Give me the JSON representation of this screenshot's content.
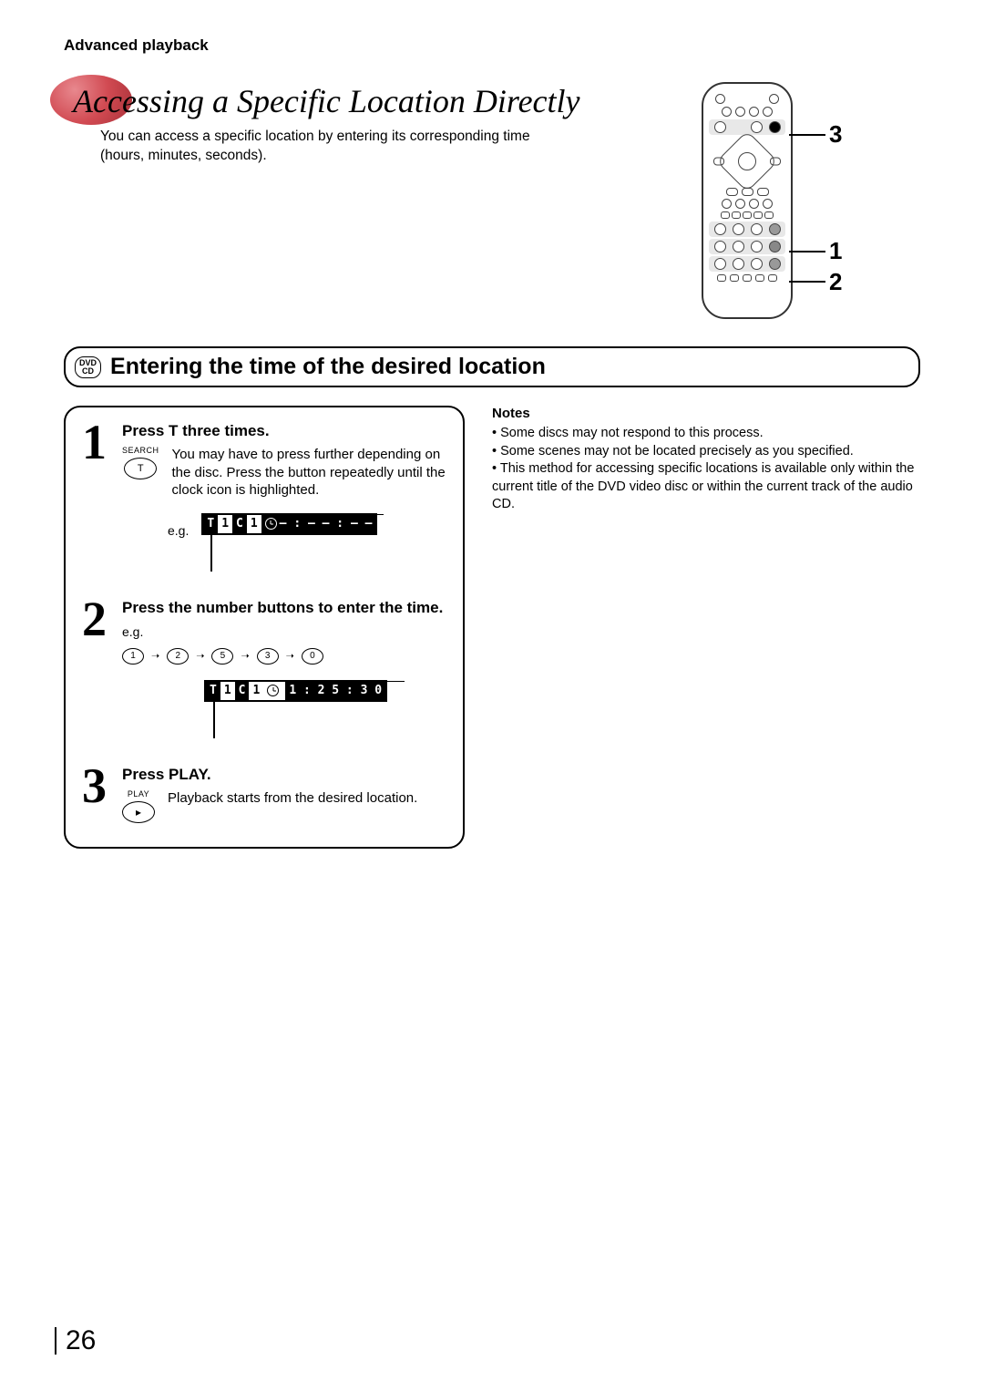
{
  "header": {
    "section": "Advanced playback"
  },
  "title": "Accessing a Specific Location Directly",
  "description": "You can access a specific location by entering its corresponding time (hours, minutes, seconds).",
  "remote_callouts": [
    "3",
    "1",
    "2"
  ],
  "section_heading": {
    "media": [
      "DVD",
      "CD"
    ],
    "text": "Entering the time of the desired location"
  },
  "steps": [
    {
      "num": "1",
      "title": "Press T three times.",
      "button": {
        "label": "SEARCH",
        "glyph": "T"
      },
      "text": "You may have to press further depending on the disc. Press the button repeatedly until the clock icon is highlighted.",
      "eg_label": "e.g.",
      "osd": {
        "t": "T",
        "t_val": "1",
        "c": "C",
        "c_val": "1",
        "time": "– : – – : – –",
        "clock_highlit": false
      }
    },
    {
      "num": "2",
      "title": "Press the number buttons to enter the time.",
      "eg_label": "e.g.",
      "sequence": [
        "1",
        "2",
        "5",
        "3",
        "0"
      ],
      "osd": {
        "t": "T",
        "t_val": "1",
        "c": "C",
        "c_val": "1",
        "time": "1 : 2 5 : 3 0"
      }
    },
    {
      "num": "3",
      "title": "Press PLAY.",
      "button": {
        "label": "PLAY",
        "glyph": "▸"
      },
      "text": "Playback starts from the desired location."
    }
  ],
  "notes": {
    "heading": "Notes",
    "items": [
      "Some discs may not respond to this process.",
      "Some scenes may not be located precisely as you specified.",
      "This method for accessing specific locations is available only within the current title of the DVD video disc or within the current track of the audio CD."
    ]
  },
  "page_number": "26"
}
